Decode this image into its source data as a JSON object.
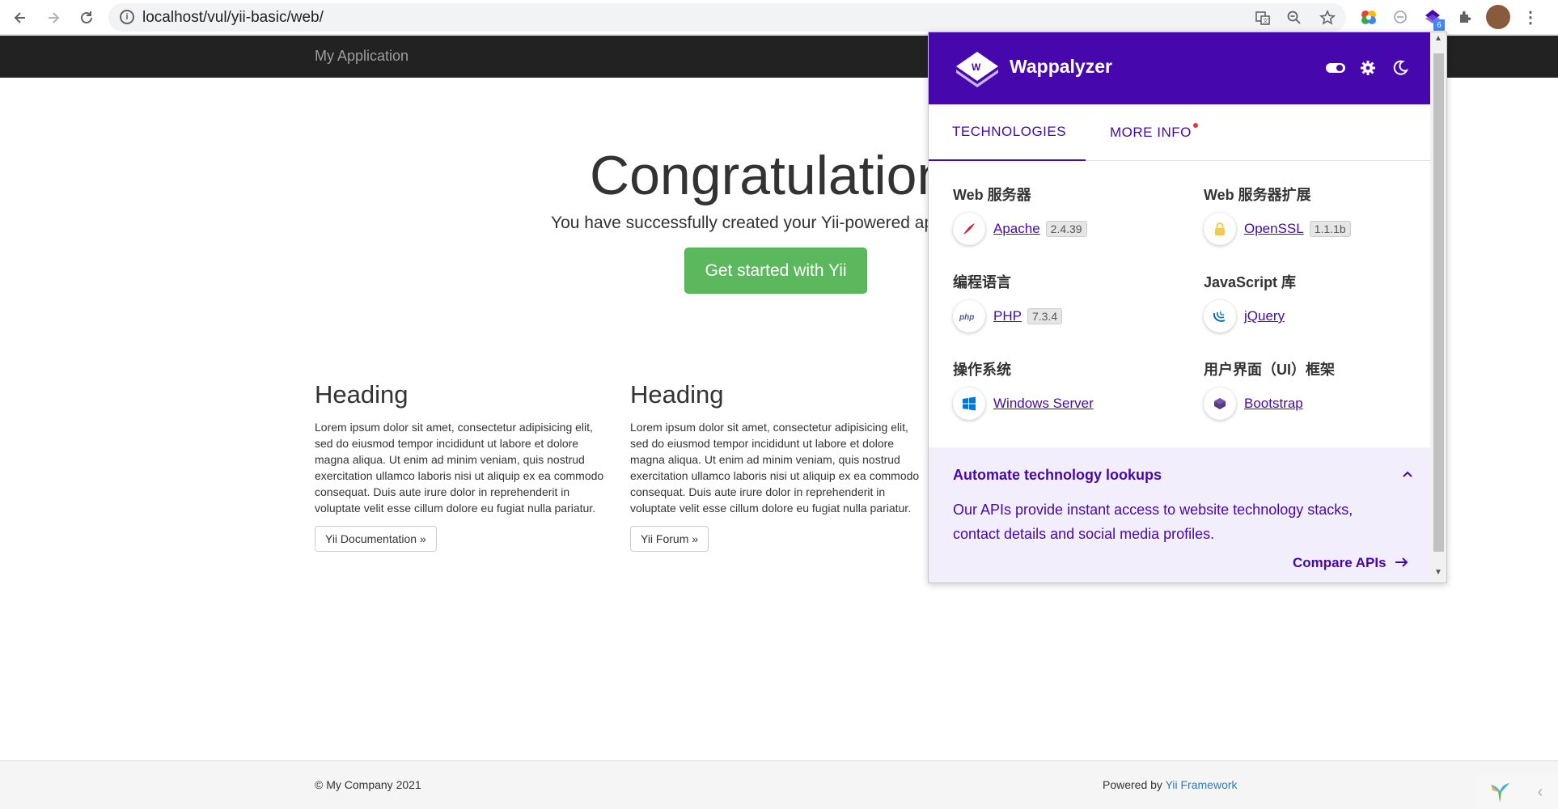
{
  "browser": {
    "url": "localhost/vul/yii-basic/web/",
    "extension_badge": "6"
  },
  "app": {
    "brand": "My Application",
    "jumbotron": {
      "title": "Congratulations!",
      "lead": "You have successfully created your Yii-powered application.",
      "button": "Get started with Yii"
    },
    "columns": [
      {
        "heading": "Heading",
        "text": "Lorem ipsum dolor sit amet, consectetur adipisicing elit, sed do eiusmod tempor incididunt ut labore et dolore magna aliqua. Ut enim ad minim veniam, quis nostrud exercitation ullamco laboris nisi ut aliquip ex ea commodo consequat. Duis aute irure dolor in reprehenderit in voluptate velit esse cillum dolore eu fugiat nulla pariatur.",
        "button": "Yii Documentation »"
      },
      {
        "heading": "Heading",
        "text": "Lorem ipsum dolor sit amet, consectetur adipisicing elit, sed do eiusmod tempor incididunt ut labore et dolore magna aliqua. Ut enim ad minim veniam, quis nostrud exercitation ullamco laboris nisi ut aliquip ex ea commodo consequat. Duis aute irure dolor in reprehenderit in voluptate velit esse cillum dolore eu fugiat nulla pariatur.",
        "button": "Yii Forum »"
      }
    ],
    "footer": {
      "copyright": "© My Company 2021",
      "powered_prefix": "Powered by ",
      "powered_link": "Yii Framework"
    }
  },
  "wappalyzer": {
    "title": "Wappalyzer",
    "tabs": [
      "TECHNOLOGIES",
      "MORE INFO"
    ],
    "categories": [
      {
        "name": "Web 服务器",
        "tech": "Apache",
        "version": "2.4.39"
      },
      {
        "name": "Web 服务器扩展",
        "tech": "OpenSSL",
        "version": "1.1.1b"
      },
      {
        "name": "编程语言",
        "tech": "PHP",
        "version": "7.3.4"
      },
      {
        "name": "JavaScript 库",
        "tech": "jQuery",
        "version": ""
      },
      {
        "name": "操作系统",
        "tech": "Windows Server",
        "version": ""
      },
      {
        "name": "用户界面（UI）框架",
        "tech": "Bootstrap",
        "version": ""
      }
    ],
    "promo": {
      "title": "Automate technology lookups",
      "text": "Our APIs provide instant access to website technology stacks, contact details and social media profiles.",
      "link": "Compare APIs"
    }
  },
  "colors": {
    "wappalyzer_purple": "#4608ad",
    "success_green": "#5cb85c",
    "navbar": "#222222"
  }
}
